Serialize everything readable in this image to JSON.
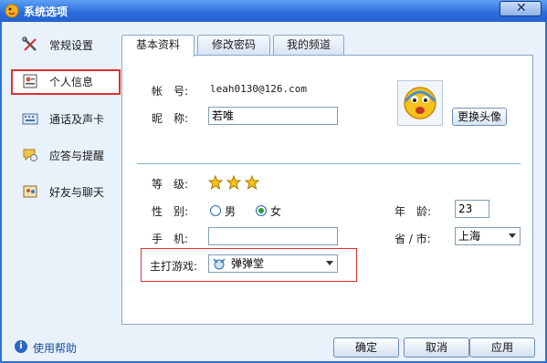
{
  "window": {
    "title": "系统选项",
    "close_symbol": "✕"
  },
  "sidebar": {
    "items": [
      {
        "label": "常规设置",
        "icon": "wrench-scissors-icon"
      },
      {
        "label": "个人信息",
        "icon": "id-card-icon",
        "selected": true
      },
      {
        "label": "通话及声卡",
        "icon": "keyboard-icon"
      },
      {
        "label": "应答与提醒",
        "icon": "chat-bubble-icon"
      },
      {
        "label": "好友与聊天",
        "icon": "friends-icon"
      }
    ]
  },
  "tabs": [
    {
      "label": "基本资料",
      "active": true
    },
    {
      "label": "修改密码"
    },
    {
      "label": "我的频道"
    }
  ],
  "profile": {
    "account_label": "帐　号:",
    "account_value": "leah0130@126.com",
    "nickname_label": "昵　称:",
    "nickname_value": "若唯",
    "change_avatar_label": "更换头像",
    "level_label": "等　级:",
    "level_stars": 3,
    "gender_label": "性　别:",
    "gender_male": "男",
    "gender_female": "女",
    "gender_selected": "女",
    "age_label": "年　龄:",
    "age_value": "23",
    "phone_label": "手　机:",
    "phone_value": "",
    "city_label": "省 / 市:",
    "city_value": "上海",
    "main_game_label": "主打游戏:",
    "main_game_value": "弹弹堂"
  },
  "footer": {
    "help_label": "使用帮助",
    "ok_label": "确定",
    "cancel_label": "取消",
    "apply_label": "应用"
  },
  "colors": {
    "titlebar": "#2a6bdc",
    "highlight_border": "#e03030",
    "client_bg": "#e9f1fb"
  }
}
